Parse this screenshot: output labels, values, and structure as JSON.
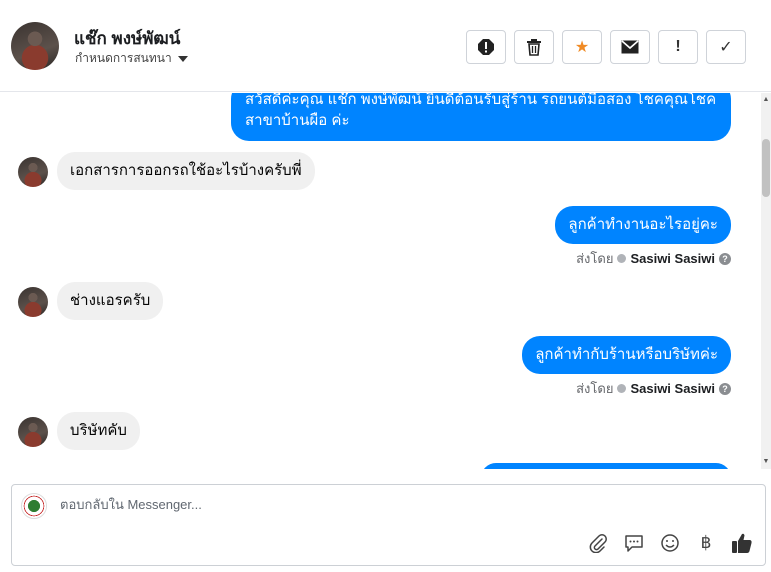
{
  "header": {
    "contact_name": "แช๊ก พงษ์พัฒน์",
    "subtitle": "กำหนดการสนทนา",
    "toolbar": {
      "report": "!",
      "delete": "🗑",
      "star": "★",
      "mail": "✉",
      "alert": "!",
      "done": "✓"
    }
  },
  "thread": {
    "messages": [
      {
        "dir": "out",
        "text": "สวัสดีค่ะคุณ แช๊ก พงษ์พัฒน์ ยินดีต้อนรับสู่ร้าน รถยนต์มือสอง โชคคุณโชค สาขาบ้านผือ ค่ะ"
      },
      {
        "dir": "in",
        "text": "เอกสารการออกรถใช้อะไรบ้างครับพี่"
      },
      {
        "dir": "out",
        "text": "ลูกค้าทำงานอะไรอยู่คะ",
        "sent_by_label": "ส่งโดย",
        "sent_by_name": "Sasiwi Sasiwi"
      },
      {
        "dir": "in",
        "text": "ช่างแอรครับ"
      },
      {
        "dir": "out",
        "text": "ลูกค้าทำกับร้านหรือบริษัทค่ะ",
        "sent_by_label": "ส่งโดย",
        "sent_by_name": "Sasiwi Sasiwi"
      },
      {
        "dir": "in",
        "text": "บริษัทคับ"
      }
    ]
  },
  "composer": {
    "placeholder": "ตอบกลับใน Messenger...",
    "icons": [
      "paperclip-icon",
      "comment-icon",
      "emoji-icon",
      "baht-icon",
      "thumbs-up-icon"
    ],
    "baht_symbol": "฿"
  },
  "colors": {
    "accent": "#0084ff",
    "star": "#f08a24",
    "incoming_bubble": "#f0f0f0"
  }
}
